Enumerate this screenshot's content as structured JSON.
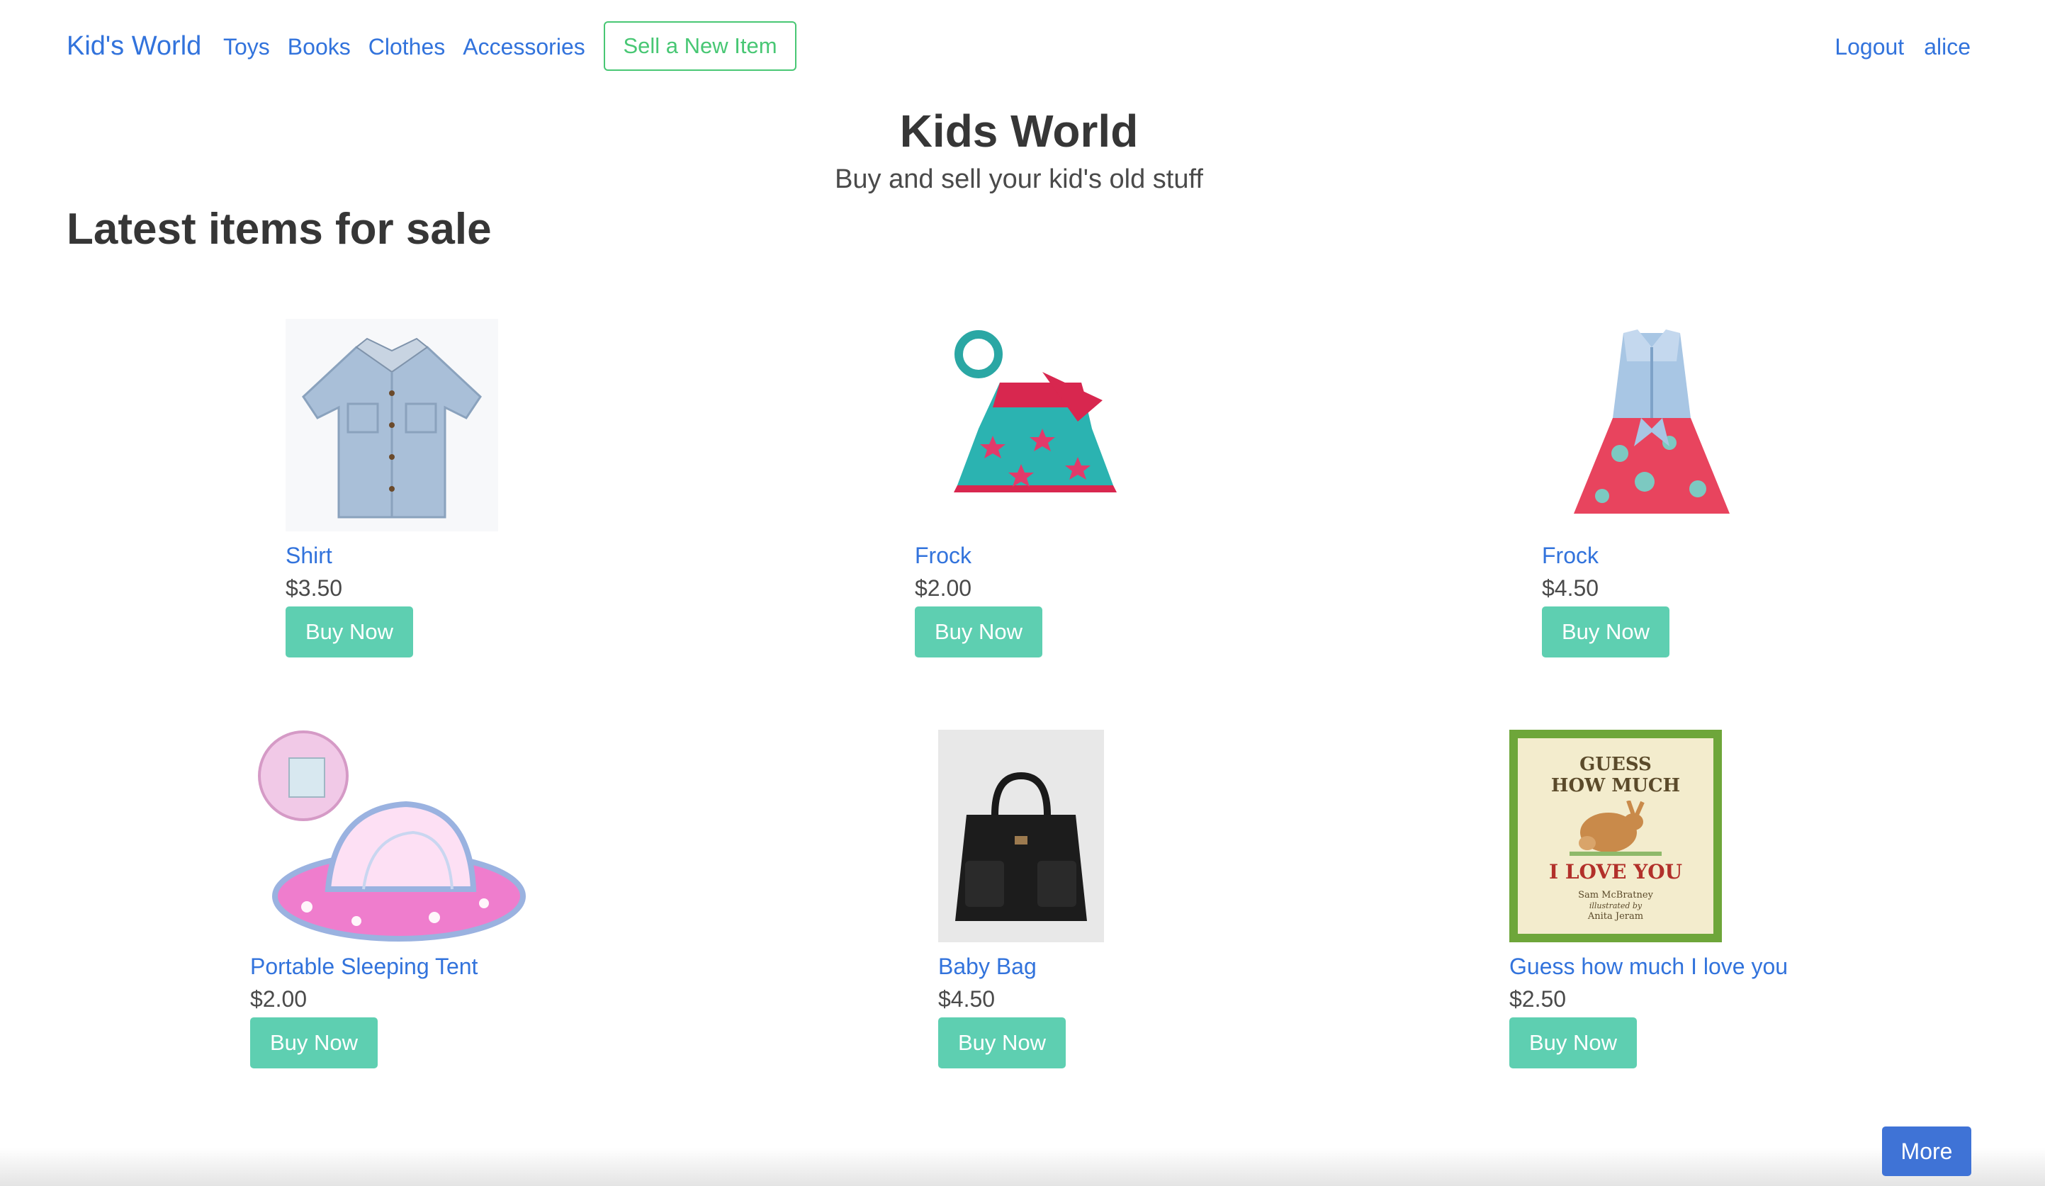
{
  "nav": {
    "brand": "Kid's World",
    "links": [
      "Toys",
      "Books",
      "Clothes",
      "Accessories"
    ],
    "sell_button": "Sell a New Item",
    "logout": "Logout",
    "username": "alice"
  },
  "hero": {
    "title": "Kids World",
    "subtitle": "Buy and sell your kid's old stuff"
  },
  "section_title": "Latest items for sale",
  "items": [
    {
      "name": "Shirt",
      "price": "$3.50",
      "button": "Buy Now",
      "image": "shirt-image"
    },
    {
      "name": "Frock",
      "price": "$2.00",
      "button": "Buy Now",
      "image": "frock-image"
    },
    {
      "name": "Frock",
      "price": "$4.50",
      "button": "Buy Now",
      "image": "frock-image"
    },
    {
      "name": "Portable Sleeping Tent",
      "price": "$2.00",
      "button": "Buy Now",
      "image": "tent-image"
    },
    {
      "name": "Baby Bag",
      "price": "$4.50",
      "button": "Buy Now",
      "image": "bag-image"
    },
    {
      "name": "Guess how much I love you",
      "price": "$2.50",
      "button": "Buy Now",
      "image": "book-image"
    }
  ],
  "book_cover": {
    "line1": "GUESS",
    "line2": "HOW MUCH",
    "line3": "I LOVE YOU",
    "author": "Sam McBratney",
    "illustrated": "illustrated by",
    "illustrator": "Anita Jeram"
  },
  "more_button": "More",
  "colors": {
    "link": "#3273dc",
    "success": "#48c774",
    "buy": "#5ecfb1",
    "more": "#3f73d6"
  }
}
